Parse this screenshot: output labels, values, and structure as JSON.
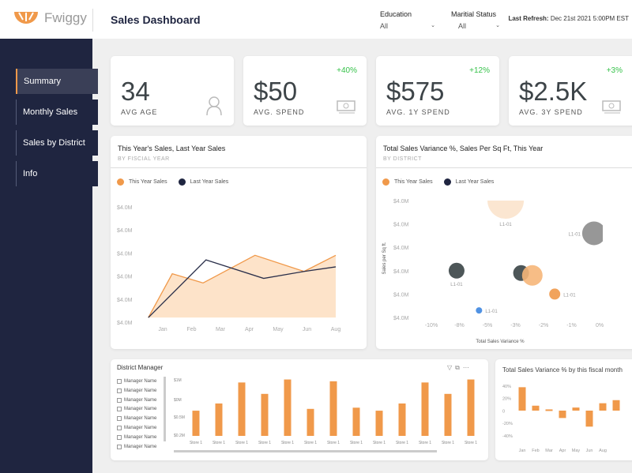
{
  "header": {
    "brand": "Fwiggy",
    "title": "Sales Dashboard",
    "filters": [
      {
        "label": "Education",
        "value": "All"
      },
      {
        "label": "Maritial Status",
        "value": "All"
      }
    ],
    "refresh_label": "Last Refresh:",
    "refresh_value": "Dec 21st 2021 5:00PM EST"
  },
  "colors": {
    "accent": "#f0994a",
    "navy": "#1f2540",
    "positive": "#36c24a"
  },
  "sidebar": {
    "items": [
      {
        "label": "Summary",
        "active": true
      },
      {
        "label": "Monthly Sales"
      },
      {
        "label": "Sales by District"
      },
      {
        "label": "Info"
      }
    ]
  },
  "kpis": [
    {
      "value": "34",
      "label": "AVG AGE",
      "change": "",
      "icon": "person-icon"
    },
    {
      "value": "$50",
      "label": "AVG. SPEND",
      "change": "+40%",
      "icon": "money-icon"
    },
    {
      "value": "$575",
      "label": "AVG. 1Y SPEND",
      "change": "+12%",
      "icon": "money-icon"
    },
    {
      "value": "$2.5K",
      "label": "AVG. 3Y SPEND",
      "change": "+3%",
      "icon": "money-icon"
    }
  ],
  "chart_data": [
    {
      "type": "area",
      "title": "This Year's Sales, Last Year Sales",
      "subtitle": "BY FISCIAL YEAR",
      "legend": [
        "This Year Sales",
        "Last Year Sales"
      ],
      "legend_placement": "top-left",
      "y_ticks": [
        "$4.0M",
        "$4.0M",
        "$4.0M",
        "$4.0M",
        "$4.0M",
        "$4.0M"
      ],
      "x_ticks": [
        "Jan",
        "Feb",
        "Mar",
        "Apr",
        "May",
        "Jun",
        "Aug"
      ],
      "series": [
        {
          "name": "This Year Sales",
          "color": "#f0994a",
          "fill": "#fde3c9",
          "points": [
            [
              -0.5,
              0.2
            ],
            [
              0.33,
              2.1
            ],
            [
              1.4,
              1.7
            ],
            [
              3.2,
              2.9
            ],
            [
              4.9,
              2.2
            ],
            [
              6,
              2.9
            ]
          ]
        },
        {
          "name": "Last Year Sales",
          "color": "#2a2f4a",
          "points": [
            [
              -0.5,
              0.2
            ],
            [
              1.5,
              2.7
            ],
            [
              3.5,
              1.9
            ],
            [
              4.9,
              2.2
            ],
            [
              6,
              2.4
            ]
          ]
        }
      ]
    },
    {
      "type": "scatter",
      "title": "Total Sales Variance %, Sales Per Sq Ft, This Year",
      "subtitle": "BY DISTRICT",
      "legend": [
        "This Year Sales",
        "Last Year Sales"
      ],
      "xlabel": "Total Sales Variance %",
      "ylabel": "Sales per Sq ft.",
      "x_ticks": [
        "-10%",
        "-8%",
        "-5%",
        "-3%",
        "-2%",
        "-1%",
        "0%"
      ],
      "x_tick_values": [
        -10,
        -8,
        -5,
        -3,
        -2,
        -1,
        0
      ],
      "y_ticks": [
        "$4.0M",
        "$4.0M",
        "$4.0M",
        "$4.0M",
        "$4.0M",
        "$4.0M"
      ],
      "points": [
        {
          "x": -3.7,
          "y": 5,
          "size": 23,
          "color": "#fbe3cc",
          "label": "L1-01"
        },
        {
          "x": -0.2,
          "y": 3.6,
          "size": 15,
          "color": "#8c8c8c",
          "label": "L1-01"
        },
        {
          "x": -8.2,
          "y": 2,
          "size": 10,
          "color": "#3a4446",
          "label": "L1-01"
        },
        {
          "x": -2.8,
          "y": 1.9,
          "size": 10,
          "color": "#3a4446",
          "label": ""
        },
        {
          "x": -2.4,
          "y": 1.8,
          "size": 13,
          "color": "#f6b679",
          "label": ""
        },
        {
          "x": -1.6,
          "y": 1.0,
          "size": 7,
          "color": "#f0994a",
          "label": "L1-01"
        },
        {
          "x": -5.9,
          "y": 0.3,
          "size": 4,
          "color": "#3d86e0",
          "label": "L1-01"
        }
      ]
    },
    {
      "type": "bar",
      "title": "District Manager",
      "y_ticks": [
        "$1M",
        "$0M",
        "$0.5M",
        "$0.2M"
      ],
      "categories": [
        "Store 1",
        "Store 1",
        "Store 1",
        "Store 1",
        "Store 1",
        "Store 1",
        "Store 1",
        "Store 1",
        "Store 1",
        "Store 1",
        "Store 1",
        "Store 1",
        "Store 1"
      ],
      "values": [
        0.42,
        0.54,
        0.89,
        0.7,
        0.94,
        0.45,
        0.91,
        0.47,
        0.42,
        0.54,
        0.89,
        0.7,
        0.94
      ],
      "color": "#f0994a",
      "filter_items": [
        "Manager Name",
        "Manager Name",
        "Manager Name",
        "Manager Name",
        "Manager Name",
        "Manager Name",
        "Manager Name",
        "Manager Name"
      ]
    },
    {
      "type": "bar",
      "title": "Total Sales Variance % by this fiscal month",
      "y_ticks": [
        "40%",
        "20%",
        "0",
        "-20%",
        "-40%"
      ],
      "ylim": [
        -40,
        40
      ],
      "x_ticks": [
        "Jan",
        "Feb",
        "Mar",
        "Apr",
        "May",
        "Jun",
        "Aug"
      ],
      "values": [
        38,
        8,
        2,
        -12,
        5,
        -26,
        12,
        17
      ],
      "color": "#f0994a"
    }
  ]
}
